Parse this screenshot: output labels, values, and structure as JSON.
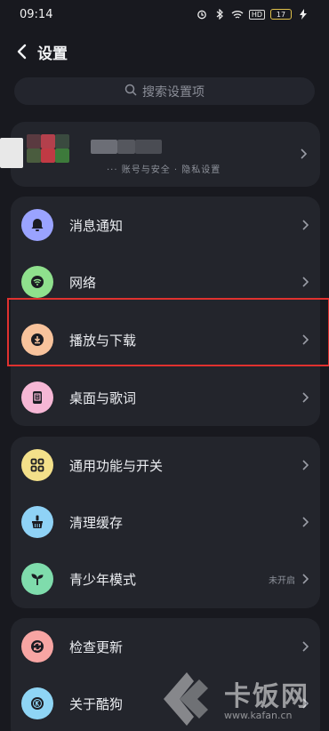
{
  "status_bar": {
    "time": "09:14",
    "hd_label": "HD",
    "battery_level": "17"
  },
  "header": {
    "title": "设置"
  },
  "search": {
    "placeholder": "搜索设置项"
  },
  "profile": {
    "sub_text": "··· 账号与安全 · 隐私设置"
  },
  "group1": {
    "items": [
      {
        "label": "消息通知",
        "icon": "bell-icon",
        "color": "#9aa3ff"
      },
      {
        "label": "网络",
        "icon": "wifi-icon",
        "color": "#8fe08d"
      },
      {
        "label": "播放与下载",
        "icon": "download-icon",
        "color": "#f8c39c"
      },
      {
        "label": "桌面与歌词",
        "icon": "lyrics-icon",
        "color": "#f6b7d5"
      }
    ]
  },
  "group2": {
    "items": [
      {
        "label": "通用功能与开关",
        "icon": "grid-icon",
        "color": "#f3e08a"
      },
      {
        "label": "清理缓存",
        "icon": "broom-icon",
        "color": "#8fd2f6"
      },
      {
        "label": "青少年模式",
        "icon": "sprout-icon",
        "color": "#7fdcac",
        "status": "未开启"
      }
    ]
  },
  "group3": {
    "items": [
      {
        "label": "检查更新",
        "icon": "refresh-icon",
        "color": "#f7a5a3"
      },
      {
        "label": "关于酷狗",
        "icon": "kugou-icon",
        "color": "#8fd5f5"
      }
    ]
  },
  "watermark": {
    "text": "卡饭网",
    "url": "www.kafan.cn"
  }
}
